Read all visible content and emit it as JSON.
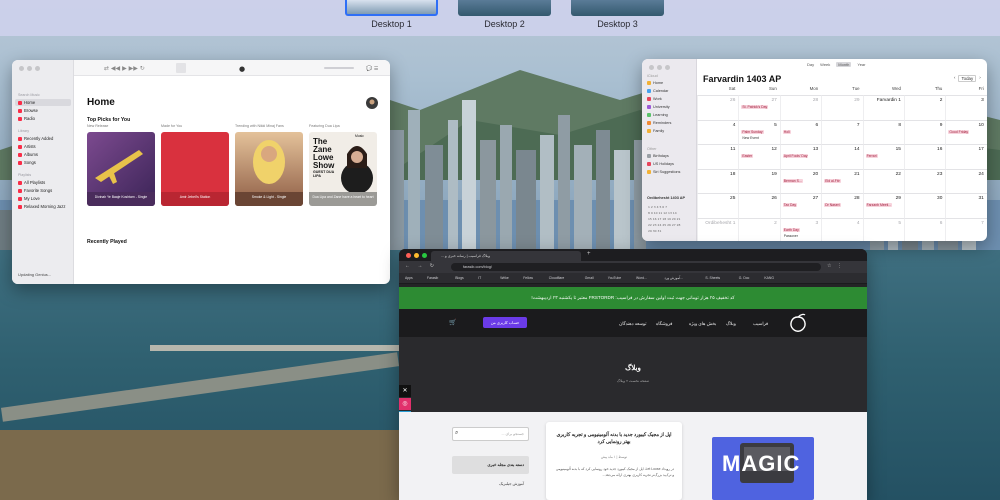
{
  "spaces": [
    {
      "label": "Desktop 1",
      "active": true
    },
    {
      "label": "Desktop 2",
      "active": false
    },
    {
      "label": "Desktop 3",
      "active": false
    }
  ],
  "music": {
    "sidebar": {
      "search_placeholder": "Search Music",
      "section_library": "Library",
      "section_playlists": "Playlists",
      "items_main": [
        "Home",
        "Browse",
        "Radio"
      ],
      "items_library": [
        "Recently Added",
        "Artists",
        "Albums",
        "Songs"
      ],
      "items_playlists": [
        "All Playlists",
        "Favorite Songs",
        "My Love",
        "Relaxed Morning Jazz"
      ],
      "status": "Updating Genius..."
    },
    "title": "Home",
    "top_picks_title": "Top Picks for You",
    "captions": [
      "New Release",
      "Made for You",
      "Trending with Nikki Minaj Fans",
      "Featuring Dua Lipa"
    ],
    "cards": [
      {
        "sub": "Divinah Ye Baaje Koshtam - Single",
        "sub2": "Honbee",
        "color": "#6b3d7c"
      },
      {
        "sub": "Amir Jebeli's Station",
        "sub2": "",
        "color": "#d9313e"
      },
      {
        "sub": "Smoke & Light - Single",
        "sub2": "Jal Sonik · 2024",
        "color": "#c8a07b"
      },
      {
        "sub": "Dua Lipa and Zane have a heart to heart",
        "sub2": "",
        "color": "#f1ede7"
      }
    ],
    "card4_title": "The Zane Lowe Show",
    "card4_guest": "GUEST DUA LIPA",
    "apple_music_badge": "Music",
    "recently_played_title": "Recently Played"
  },
  "calendar": {
    "title": "Farvardin 1403 AP",
    "view_options": [
      "Day",
      "Week",
      "Month",
      "Year"
    ],
    "today_button": "Today",
    "sidebar_header_icloud": "iCloud",
    "sidebar_header_other": "Other",
    "calendars": [
      {
        "name": "Home",
        "color": "#f2b134"
      },
      {
        "name": "Calendar",
        "color": "#45a2f0"
      },
      {
        "name": "Work",
        "color": "#e8445c"
      },
      {
        "name": "University",
        "color": "#9b5bd6"
      },
      {
        "name": "Learning",
        "color": "#5ac36a"
      },
      {
        "name": "Reminders",
        "color": "#f28b34"
      },
      {
        "name": "Family",
        "color": "#f2b134"
      }
    ],
    "other_calendars": [
      {
        "name": "Birthdays",
        "color": "#9aa0a6"
      },
      {
        "name": "US Holidays",
        "color": "#e8445c"
      },
      {
        "name": "Siri Suggestions",
        "color": "#f2b134"
      }
    ],
    "mini_month": "Ordibehesht 1403 AP",
    "weekdays": [
      "Sat",
      "Sun",
      "Mon",
      "Tue",
      "Wed",
      "Thu",
      "Fri"
    ],
    "weeks": [
      [
        {
          "n": "26",
          "m": true
        },
        {
          "n": "27",
          "m": true,
          "ev": "St. Patrick's Day"
        },
        {
          "n": "28",
          "m": true
        },
        {
          "n": "29",
          "m": true
        },
        {
          "n": "Farvardin 1"
        },
        {
          "n": "2"
        },
        {
          "n": "3"
        }
      ],
      [
        {
          "n": "4"
        },
        {
          "n": "5",
          "ev": "Palm Sunday",
          "ev2": "New Event"
        },
        {
          "n": "6",
          "ev": "Holi"
        },
        {
          "n": "7"
        },
        {
          "n": "8"
        },
        {
          "n": "9"
        },
        {
          "n": "10",
          "ev": "Good Friday"
        }
      ],
      [
        {
          "n": "11"
        },
        {
          "n": "12",
          "ev": "Easter"
        },
        {
          "n": "13",
          "ev": "April Fools' Day"
        },
        {
          "n": "14"
        },
        {
          "n": "15",
          "ev": "Ferrari"
        },
        {
          "n": "16"
        },
        {
          "n": "17"
        }
      ],
      [
        {
          "n": "18"
        },
        {
          "n": "19"
        },
        {
          "n": "20",
          "ev": "Berman S..."
        },
        {
          "n": "21",
          "ev": "Eid al-Fitr"
        },
        {
          "n": "22"
        },
        {
          "n": "23"
        },
        {
          "n": "24"
        }
      ],
      [
        {
          "n": "25"
        },
        {
          "n": "26"
        },
        {
          "n": "27",
          "ev": "Tax Day"
        },
        {
          "n": "28",
          "ev": "Dr Naseri"
        },
        {
          "n": "29",
          "ev": "Farzanb Meeti..."
        },
        {
          "n": "30"
        },
        {
          "n": "31"
        }
      ],
      [
        {
          "n": "Ordibehesht 1",
          "m": true
        },
        {
          "n": "2",
          "m": true
        },
        {
          "n": "3",
          "m": true,
          "ev": "Earth Day",
          "ev2": "Passover"
        },
        {
          "n": "4",
          "m": true
        },
        {
          "n": "5",
          "m": true
        },
        {
          "n": "6",
          "m": true
        },
        {
          "n": "7",
          "m": true
        }
      ]
    ]
  },
  "browser": {
    "tab_title": "وبلاگ فراسیب | رسانه خبری و ...",
    "url": "farasib.com/blog/",
    "bookmarks": [
      "Apps",
      "Farasib",
      "Blogs",
      "IT",
      "Wrike",
      "Fellow",
      "Cloudflare",
      "Gmail",
      "YouTube",
      "Word...",
      "آموزش ورد...",
      "S. Sheets",
      "G. Doc",
      "KANG"
    ],
    "promo_text": "کد تخفیف ۲۵ هزار تومانی جهت ثبت اولین سفارش در فراسیب: FRSTORDR معتبر تا یکشنبه ۲۳ اردیبهشت!",
    "nav": [
      "فراسیب",
      "وبلاگ",
      "بخش های ویژه",
      "فروشگاه",
      "توسعه دهندگان"
    ],
    "login": "حساب کاربری من",
    "hero_title": "وبلاگ",
    "breadcrumb": "صفحه نخست » وبلاگ",
    "search_placeholder": "جستجو برای ...",
    "categories_title": "دسته بندی مجله خبری",
    "category_item": "آموزش جیلبریک",
    "post": {
      "title": "اپل از مجیک کیبورد جدید با بدنه آلومینیومی و تجربه کاربری بهتر رونمایی کرد",
      "meta": "توسط  |  ۱ ماه پیش",
      "excerpt": "در رویداد Let Loose، اپل از مجیک کیبورد جدید خود رونمایی کرد که با بدنه آلومینیومی و ترک‌پد بزرگ‌تر تجربه کاربری بهتری ارائه می‌دهد...",
      "image_text": "MAGIC"
    }
  }
}
